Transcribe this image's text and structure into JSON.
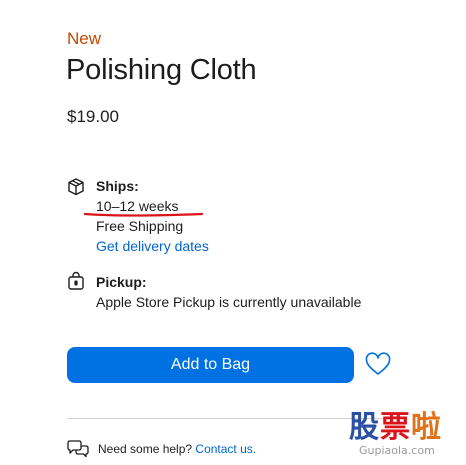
{
  "product": {
    "badge": "New",
    "name": "Polishing Cloth",
    "price": "$19.00"
  },
  "shipping": {
    "heading": "Ships:",
    "time": "10–12 weeks",
    "cost": "Free Shipping",
    "link": "Get delivery dates",
    "icon": "box-icon",
    "annotation_color": "#d9151b"
  },
  "pickup": {
    "heading": "Pickup:",
    "status": "Apple Store Pickup is currently unavailable",
    "icon": "shopping-bag-icon"
  },
  "actions": {
    "add_to_bag": "Add to Bag",
    "favorite_icon": "heart-icon",
    "accent_color": "#0071e3"
  },
  "help": {
    "prompt": "Need some help?",
    "link": "Contact us.",
    "icon": "chat-bubbles-icon"
  },
  "watermark": {
    "text": "股票啦",
    "url": "Gupiaola.com"
  }
}
